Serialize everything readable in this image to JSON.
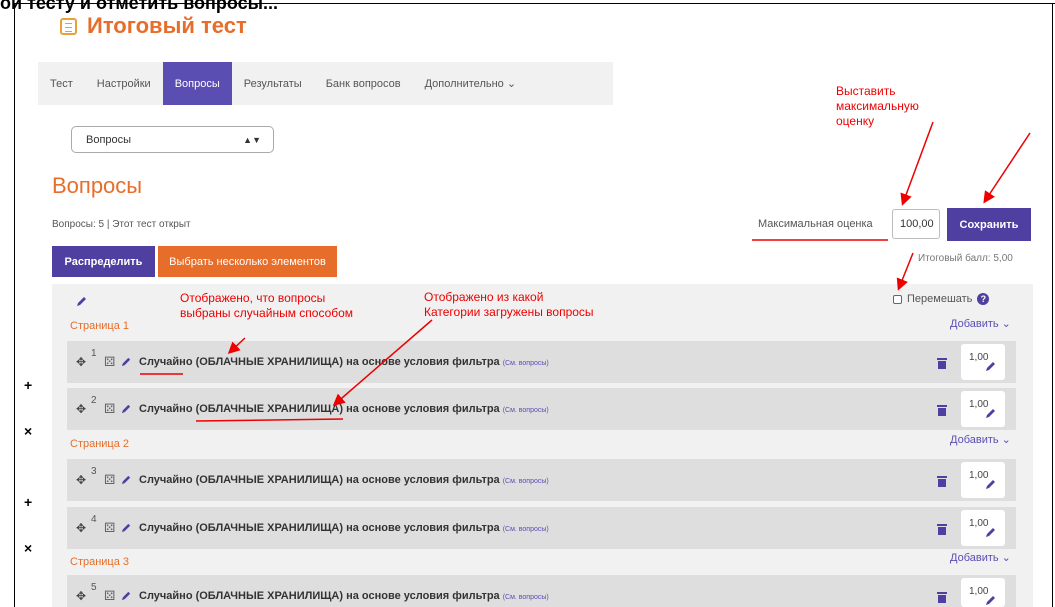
{
  "header_cut": "ой тесту и отметить вопросы...",
  "title": "Итоговый тест",
  "tabs": [
    {
      "label": "Тест"
    },
    {
      "label": "Настройки"
    },
    {
      "label": "Вопросы",
      "active": true
    },
    {
      "label": "Результаты"
    },
    {
      "label": "Банк вопросов"
    },
    {
      "label": "Дополнительно ⌄"
    }
  ],
  "nav_select": {
    "value": "Вопросы"
  },
  "heading": "Вопросы",
  "summary": "Вопросы: 5 | Этот тест открыт",
  "buttons": {
    "distribute": "Распределить",
    "select_multiple": "Выбрать несколько элементов",
    "save": "Сохранить"
  },
  "max_grade": {
    "label": "Максимальная оценка",
    "value": "100,00"
  },
  "total": "Итоговый балл: 5,00",
  "shuffle_label": "Перемешать",
  "add_label": "Добавить ⌄",
  "pages": [
    {
      "label": "Страница 1",
      "questions": [
        {
          "num": "1",
          "text": "Случайно (ОБЛАЧНЫЕ ХРАНИЛИЩА) на основе условия фильтра",
          "link": "(См. вопросы)",
          "mark": "1,00"
        },
        {
          "num": "2",
          "text": "Случайно (ОБЛАЧНЫЕ ХРАНИЛИЩА) на основе условия фильтра",
          "link": "(См. вопросы)",
          "mark": "1,00"
        }
      ]
    },
    {
      "label": "Страница 2",
      "questions": [
        {
          "num": "3",
          "text": "Случайно (ОБЛАЧНЫЕ ХРАНИЛИЩА) на основе условия фильтра",
          "link": "(См. вопросы)",
          "mark": "1,00"
        },
        {
          "num": "4",
          "text": "Случайно (ОБЛАЧНЫЕ ХРАНИЛИЩА) на основе условия фильтра",
          "link": "(См. вопросы)",
          "mark": "1,00"
        }
      ]
    },
    {
      "label": "Страница 3",
      "questions": [
        {
          "num": "5",
          "text": "Случайно (ОБЛАЧНЫЕ ХРАНИЛИЩА) на основе условия фильтра",
          "link": "(См. вопросы)",
          "mark": "1,00"
        }
      ]
    }
  ],
  "side_symbols": [
    "+",
    "×",
    "+",
    "×"
  ],
  "annotations": {
    "max_grade_hint": [
      "Выставить",
      "максимальную",
      "оценку"
    ],
    "random_hint": [
      "Отображено, что вопросы",
      "выбраны случайным способом"
    ],
    "category_hint": [
      "Отображено из какой",
      "Категории загружены вопросы"
    ]
  },
  "colors": {
    "accent_orange": "#e76e2a",
    "primary_purple": "#4f3fa0",
    "annotation_red": "#e00000"
  }
}
